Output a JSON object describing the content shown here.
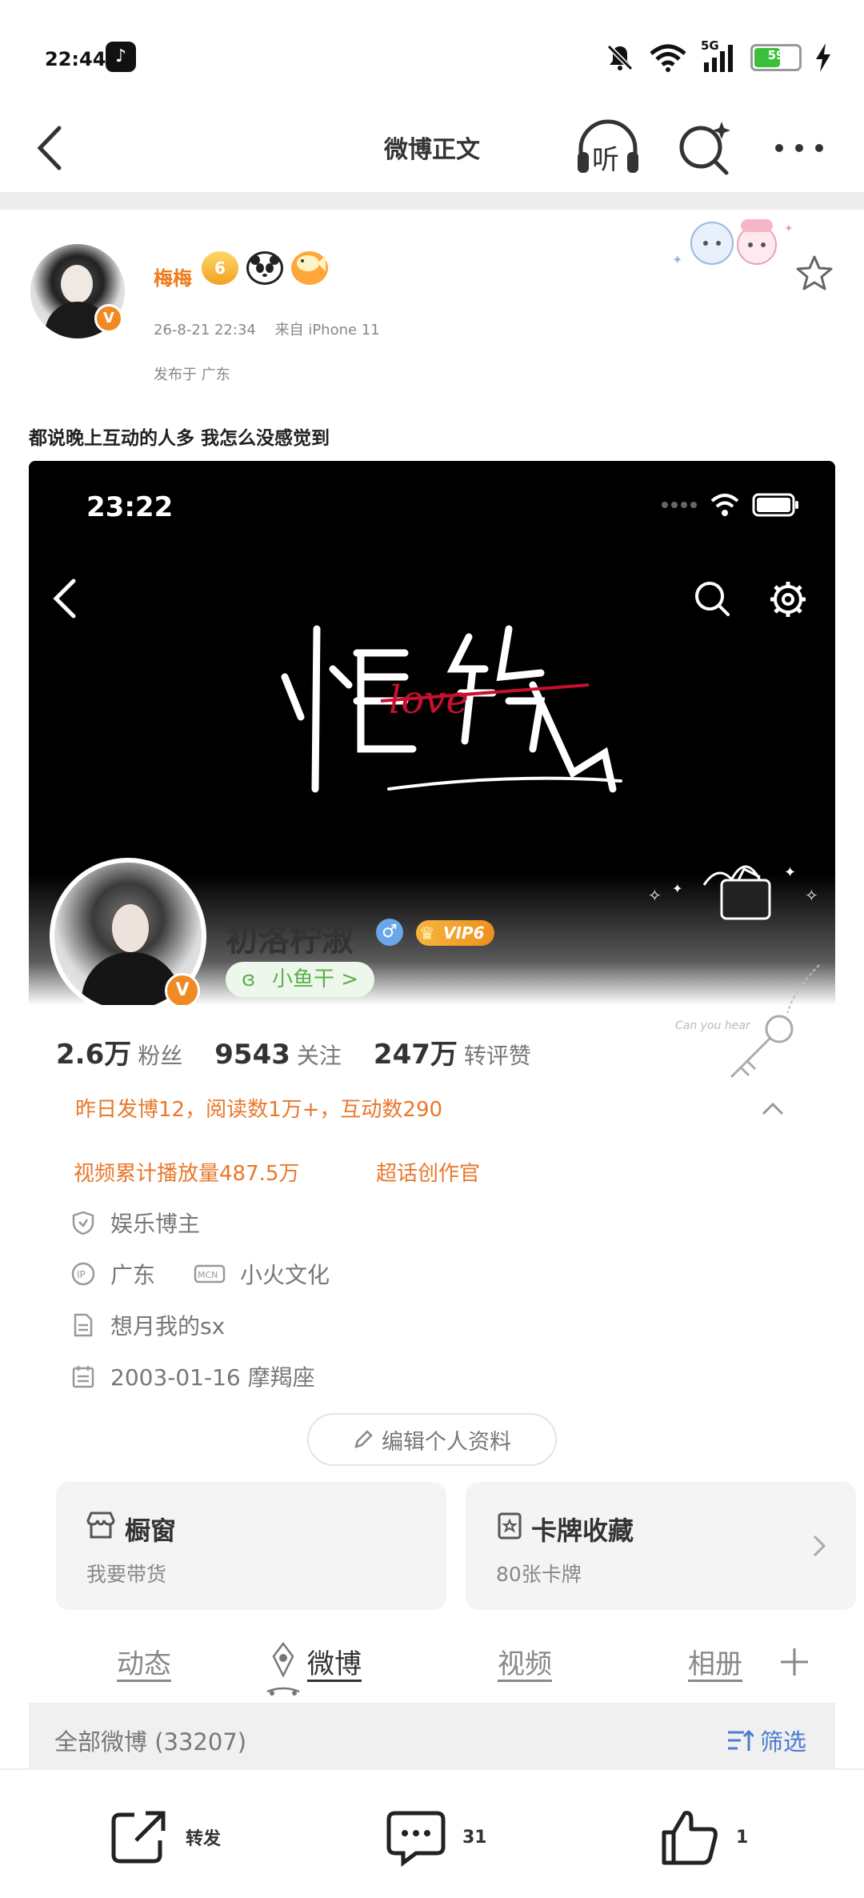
{
  "status_bar": {
    "time": "22:44",
    "network": "5G",
    "battery": "59",
    "battery_level": 0.59
  },
  "nav": {
    "title": "微博正文",
    "listen_label": "听"
  },
  "post": {
    "author": "梅梅",
    "level_badge": "6",
    "date": "26-8-21 22:34",
    "source": "来自 iPhone 11",
    "location": "发布于 广东",
    "text": "都说晚上互动的人多 我怎么没感觉到"
  },
  "embed": {
    "time": "23:22",
    "calligraphy_word": "love",
    "profile": {
      "name": "初洛柠淑",
      "vip": "VIP6",
      "fish": "小鱼干 >",
      "stats": [
        {
          "num": "2.6万",
          "label": "粉丝"
        },
        {
          "num": "9543",
          "label": "关注"
        },
        {
          "num": "247万",
          "label": "转评赞"
        }
      ],
      "activity": "昨日发博12，阅读数1万+，互动数290",
      "video_plays": "视频累计播放量487.5万",
      "super_topic": "超话创作官",
      "role": "娱乐博主",
      "ip": "广东",
      "mcn": "小火文化",
      "bio": "想月我的sx",
      "birthday": "2003-01-16 摩羯座",
      "edit_button": "编辑个人资料",
      "cards": [
        {
          "title": "橱窗",
          "sub": "我要带货"
        },
        {
          "title": "卡牌收藏",
          "sub": "80张卡牌"
        }
      ],
      "tabs": [
        "动态",
        "微博",
        "视频",
        "相册"
      ],
      "all_weibo": "全部微博 (33207)",
      "filter": "筛选"
    }
  },
  "bottom": {
    "repost": "转发",
    "comment_count": "31",
    "like_count": "1"
  },
  "colors": {
    "accent_orange": "#f07a1b",
    "link_blue": "#4a7bd0",
    "green": "#3cc03c"
  }
}
